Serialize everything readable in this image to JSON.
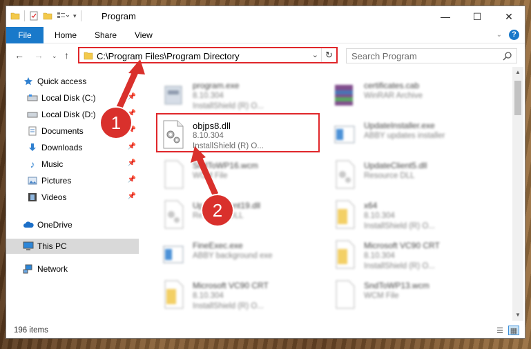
{
  "window": {
    "title": "Program"
  },
  "ribbon": {
    "file": "File",
    "home": "Home",
    "share": "Share",
    "view": "View",
    "help": "?"
  },
  "address": {
    "path": "C:\\Program Files\\Program Directory"
  },
  "search": {
    "placeholder": "Search Program"
  },
  "sidebar": {
    "items": [
      {
        "label": "Quick access",
        "icon": "star-icon"
      },
      {
        "label": "Local Disk (C:)",
        "icon": "drive-icon",
        "pinned": true
      },
      {
        "label": "Local Disk (D:)",
        "icon": "drive-icon",
        "pinned": true
      },
      {
        "label": "Documents",
        "icon": "documents-icon",
        "pinned": true
      },
      {
        "label": "Downloads",
        "icon": "downloads-icon",
        "pinned": true
      },
      {
        "label": "Music",
        "icon": "music-icon",
        "pinned": true
      },
      {
        "label": "Pictures",
        "icon": "pictures-icon",
        "pinned": true
      },
      {
        "label": "Videos",
        "icon": "videos-icon",
        "pinned": true
      },
      {
        "label": "OneDrive",
        "icon": "onedrive-icon"
      },
      {
        "label": "This PC",
        "icon": "this-pc-icon",
        "selected": true
      },
      {
        "label": "Network",
        "icon": "network-icon"
      }
    ]
  },
  "files": [
    {
      "name": "program.exe",
      "meta1": "8.10.304",
      "meta2": "InstallShield (R) O...",
      "icon": "exe-icon",
      "blurred": true
    },
    {
      "name": "certificates.cab",
      "meta1": "WinRAR Archive",
      "meta2": "",
      "icon": "archive-icon",
      "blurred": true
    },
    {
      "name": "objps8.dll",
      "meta1": "8.10.304",
      "meta2": "InstallShield (R) O...",
      "icon": "dll-gear-icon",
      "blurred": false
    },
    {
      "name": "UpdateInstaller.exe",
      "meta1": "ABBY updates installer",
      "meta2": "",
      "icon": "exe-icon",
      "blurred": true
    },
    {
      "name": "SndToWP16.wcm",
      "meta1": "WCM File",
      "meta2": "",
      "icon": "blank-file-icon",
      "blurred": true
    },
    {
      "name": "UpdateClient5.dll",
      "meta1": "Resource DLL",
      "meta2": "",
      "icon": "dll-gear-icon",
      "blurred": true
    },
    {
      "name": "UpdateClient19.dll",
      "meta1": "Resource DLL",
      "meta2": "",
      "icon": "dll-gear-icon",
      "blurred": true
    },
    {
      "name": "x64",
      "meta1": "8.10.304",
      "meta2": "InstallShield (R) O...",
      "icon": "folder-file-icon",
      "blurred": true
    },
    {
      "name": "FineExec.exe",
      "meta1": "ABBY background exe",
      "meta2": "",
      "icon": "exe-icon",
      "blurred": true
    },
    {
      "name": "Microsoft VC90 CRT",
      "meta1": "8.10.304",
      "meta2": "InstallShield (R) O...",
      "icon": "folder-file-icon",
      "blurred": true
    },
    {
      "name": "Microsoft VC90 CRT",
      "meta1": "8.10.304",
      "meta2": "InstallShield (R) O...",
      "icon": "folder-file-icon",
      "blurred": true
    },
    {
      "name": "SndToWP13.wcm",
      "meta1": "WCM File",
      "meta2": "",
      "icon": "blank-file-icon",
      "blurred": true
    }
  ],
  "status": {
    "count": "196 items"
  },
  "annotations": {
    "step1": "1",
    "step2": "2"
  },
  "colors": {
    "accent": "#1979ca",
    "annotation": "#e0262a",
    "step_badge": "#d9302c"
  }
}
